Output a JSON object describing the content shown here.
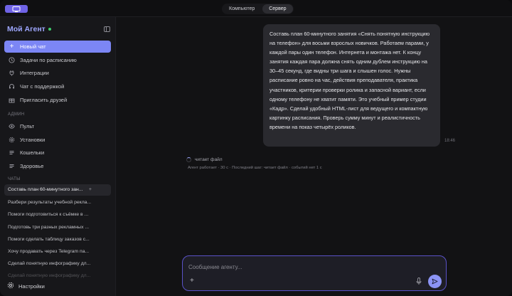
{
  "topbar": {
    "tabs": [
      {
        "label": "Компьютер",
        "active": false
      },
      {
        "label": "Сервер",
        "active": true
      }
    ]
  },
  "sidebar": {
    "brand": "Мой Агент",
    "new_chat": "Новый чат",
    "items": [
      {
        "label": "Задачи по расписанию",
        "icon": "clock-icon"
      },
      {
        "label": "Интеграции",
        "icon": "plug-icon"
      },
      {
        "label": "Чат с поддержкой",
        "icon": "headset-icon"
      },
      {
        "label": "Пригласить друзей",
        "icon": "gift-icon"
      }
    ],
    "admin_label": "АДМИН",
    "admin_items": [
      {
        "label": "Пульт",
        "icon": "eye-icon"
      },
      {
        "label": "Установки",
        "icon": "gear-icon"
      },
      {
        "label": "Кошельки",
        "icon": "list-icon"
      },
      {
        "label": "Здоровье",
        "icon": "list-icon"
      }
    ],
    "chats_label": "ЧАТЫ",
    "chats": [
      "Составь план 60-минутного зан...",
      "Разбери результаты учебной рекла...",
      "Помоги подготовиться к съёмке в ...",
      "Подготовь три разных рекламных ...",
      "Помоги сделать таблицу заказов с...",
      "Хочу продавать через Telegram па...",
      "Сделай понятную инфографику дл...",
      "Сделай понятную инфографику дл..."
    ],
    "settings": "Настройки"
  },
  "message": {
    "text": "Составь план 60-минутного занятия «Снять понятную инструкцию на телефон» для восьми взрослых новичков. Работаем парами, у каждой пары один телефон. Интернета и монтажа нет. К концу занятия каждая пара должна снять одним дублем инструкцию на 30–45 секунд, где видны три шага и слышен голос. Нужны расписание ровно на час, действия преподавателя, практика участников, критерии проверки ролика и запасной вариант, если одному телефону не хватит памяти. Это учебный пример студии «Кадр». Сделай удобный HTML-лист для ведущего и компактную картинку расписания. Проверь сумму минут и реалистичность времени на показ четырёх роликов.",
    "time": "18:46"
  },
  "agent": {
    "status": "читает файл",
    "meta": "Агент работает · 30 с · Последний шаг: читает файл · событий нет 1 с"
  },
  "composer": {
    "placeholder": "Сообщение агенту..."
  },
  "colors": {
    "accent": "#7c86f5",
    "brand": "#9ea7ff",
    "online": "#3ecf6e"
  }
}
